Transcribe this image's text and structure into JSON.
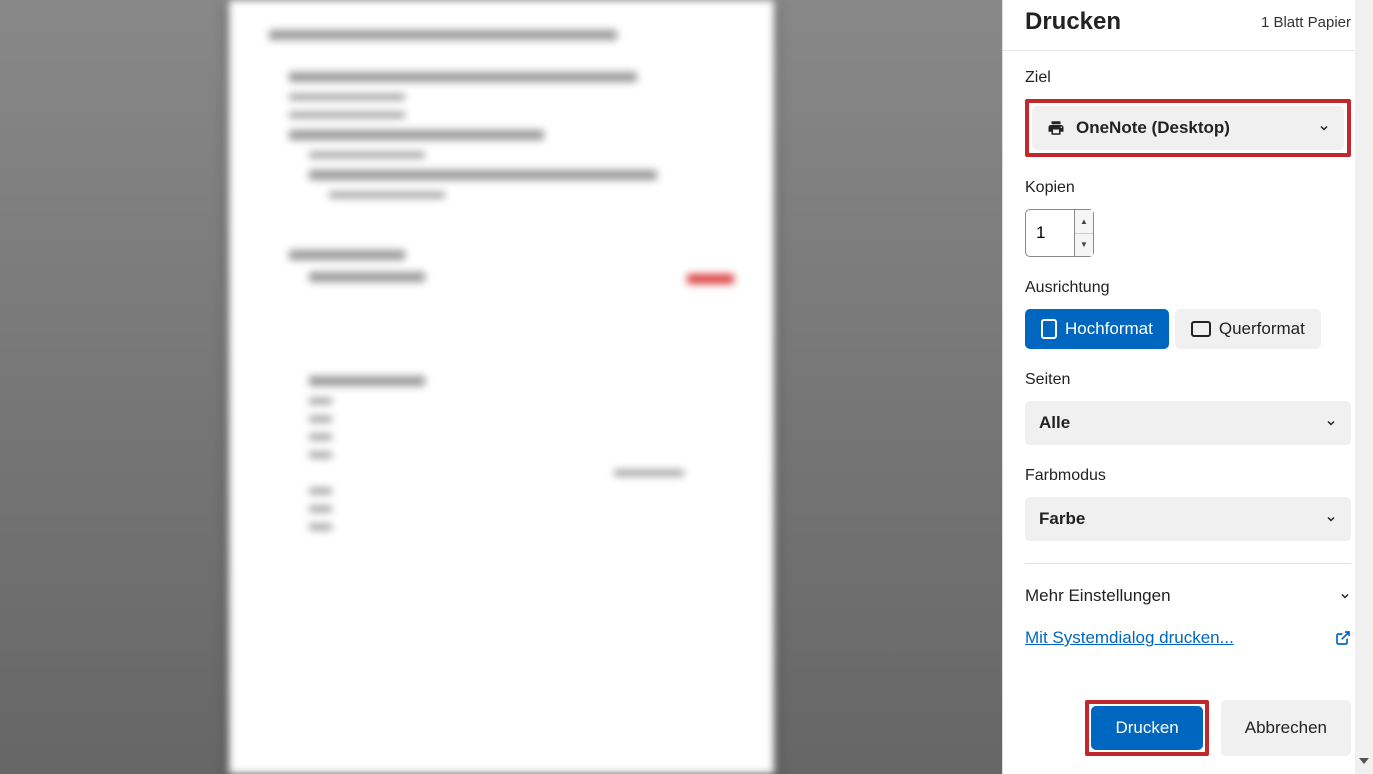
{
  "header": {
    "title": "Drucken",
    "sheets": "1 Blatt Papier"
  },
  "destination": {
    "label": "Ziel",
    "value": "OneNote (Desktop)"
  },
  "copies": {
    "label": "Kopien",
    "value": "1"
  },
  "orientation": {
    "label": "Ausrichtung",
    "portrait": "Hochformat",
    "landscape": "Querformat"
  },
  "pages": {
    "label": "Seiten",
    "value": "Alle"
  },
  "color": {
    "label": "Farbmodus",
    "value": "Farbe"
  },
  "more_settings": "Mehr Einstellungen",
  "system_dialog": "Mit Systemdialog drucken...",
  "footer": {
    "print": "Drucken",
    "cancel": "Abbrechen"
  }
}
